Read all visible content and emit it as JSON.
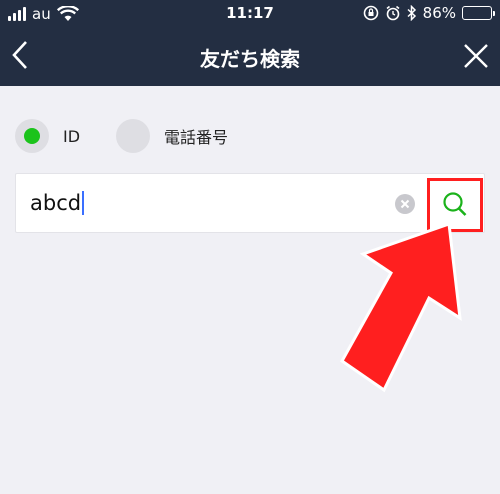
{
  "status_bar": {
    "carrier": "au",
    "time": "11:17",
    "battery": "86%",
    "battery_level": 0.86
  },
  "nav": {
    "title": "友だち検索",
    "back_icon": "chevron-left-icon",
    "close_icon": "close-icon"
  },
  "search_type": {
    "options": [
      {
        "label": "ID",
        "selected": true
      },
      {
        "label": "電話番号",
        "selected": false
      }
    ]
  },
  "search": {
    "value": "abcd"
  },
  "colors": {
    "nav_bg": "#232e42",
    "accent": "#1bc31b",
    "annotation": "#ff1f1f"
  }
}
